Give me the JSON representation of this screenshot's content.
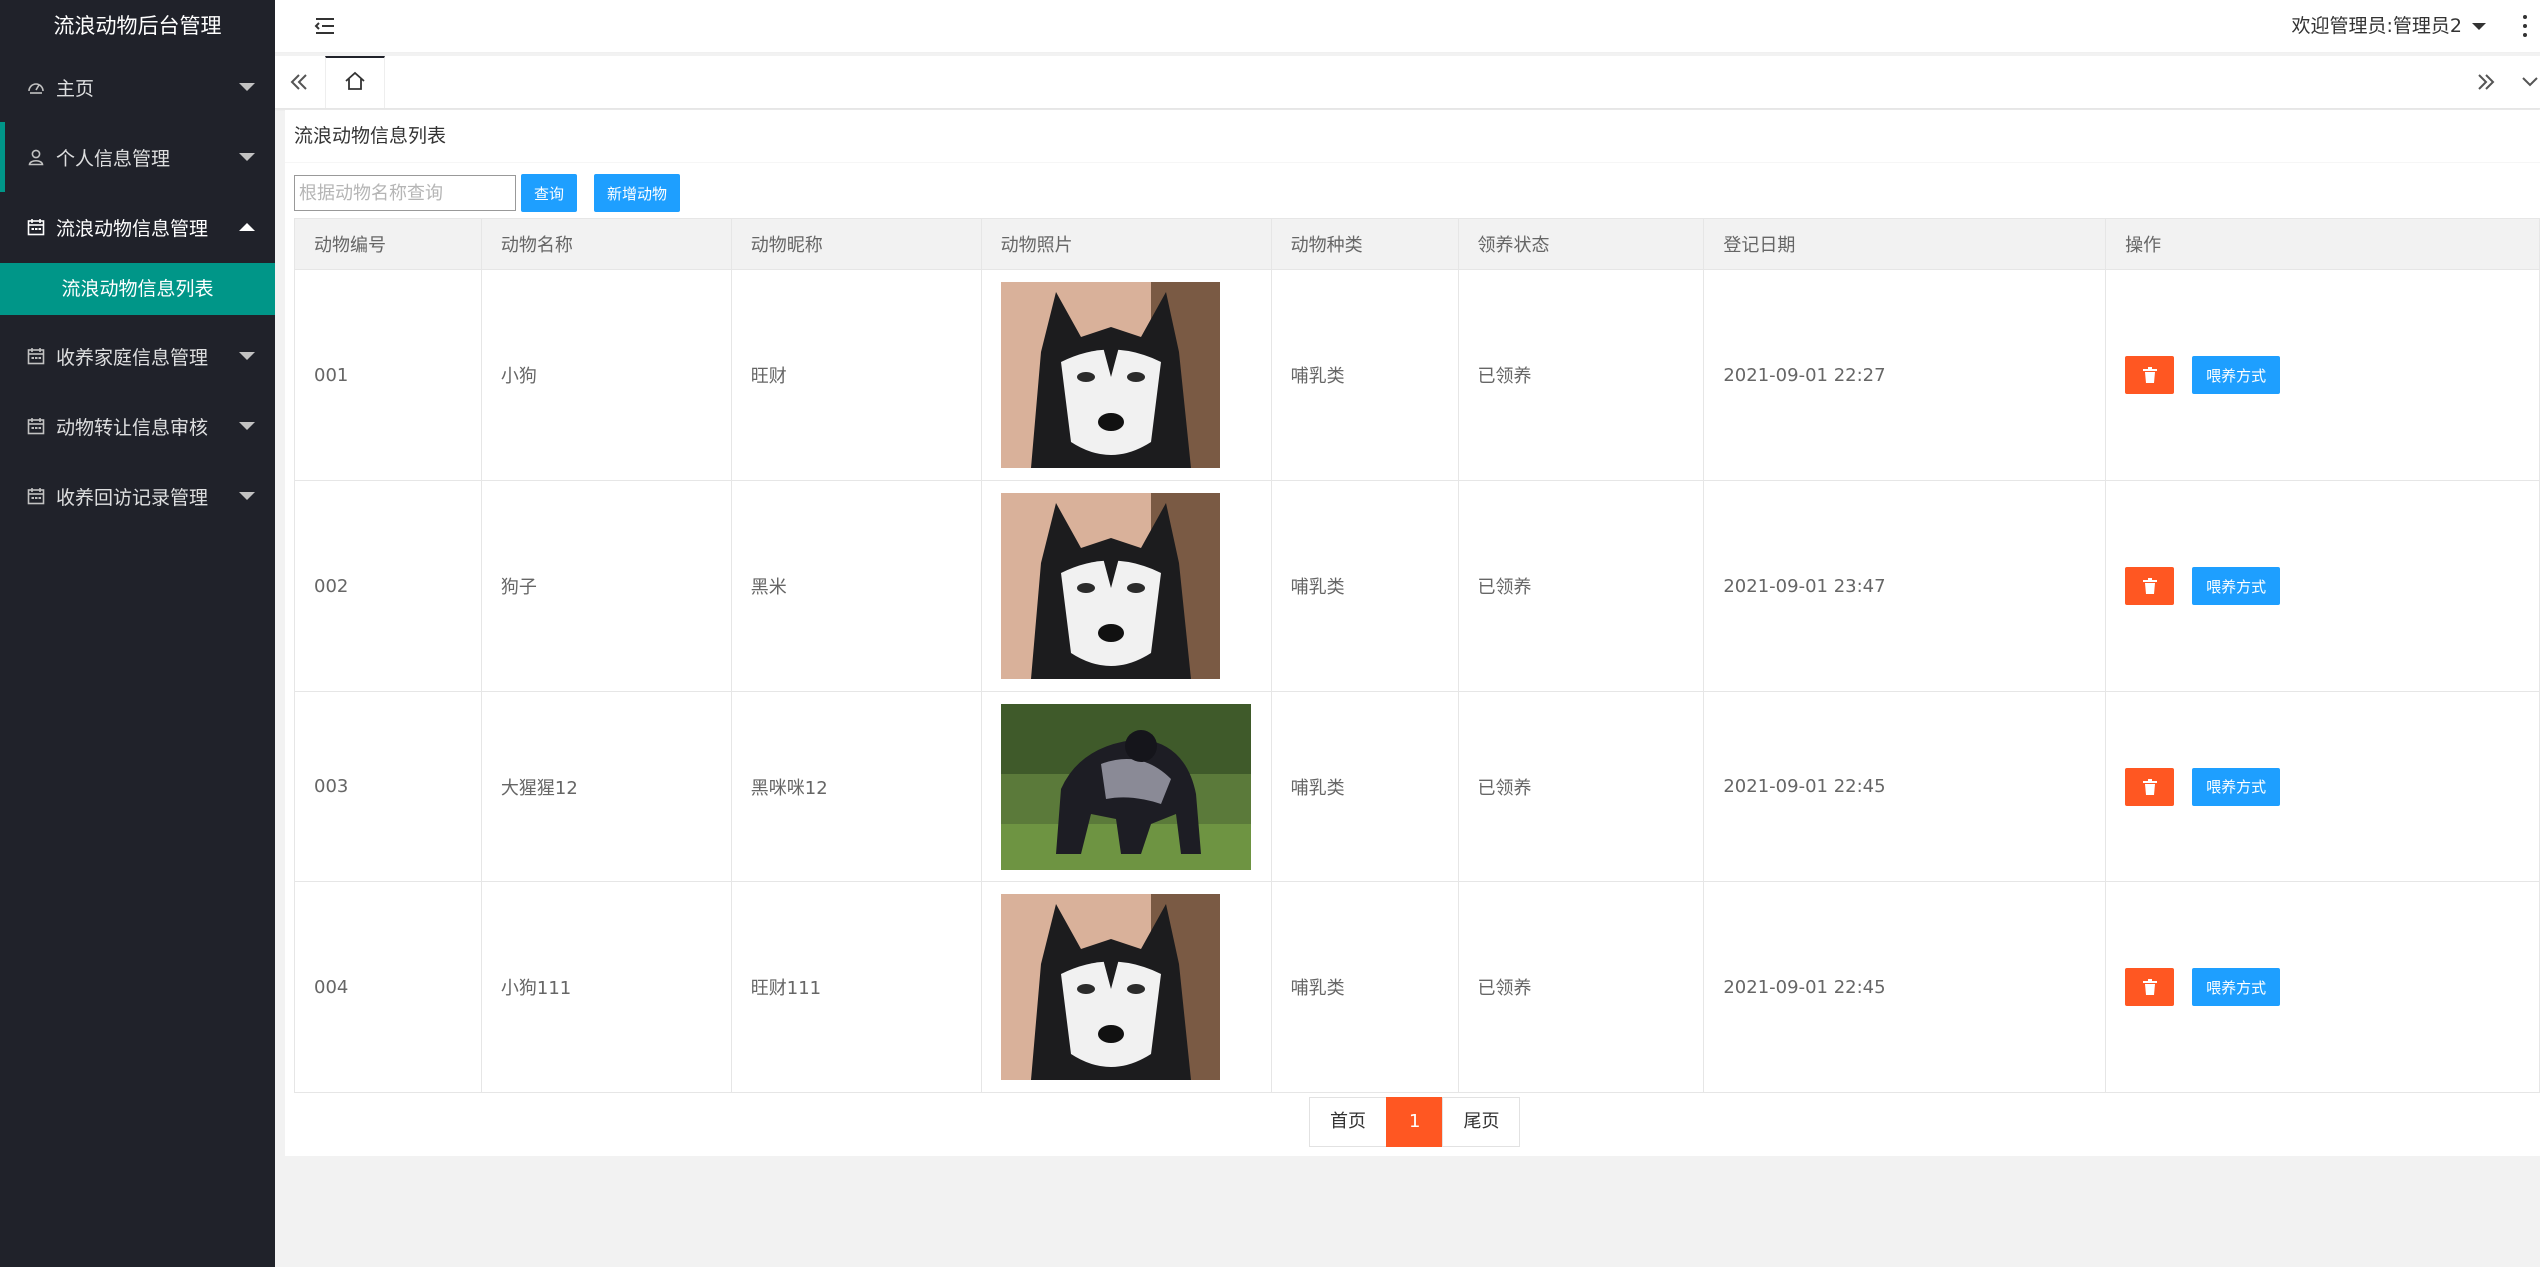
{
  "app": {
    "title": "流浪动物后台管理"
  },
  "sidebar": {
    "items": [
      {
        "label": "主页",
        "icon": "dashboard-icon"
      },
      {
        "label": "个人信息管理",
        "icon": "user-icon"
      },
      {
        "label": "流浪动物信息管理",
        "icon": "calendar-icon",
        "children": [
          {
            "label": "流浪动物信息列表"
          }
        ]
      },
      {
        "label": "收养家庭信息管理",
        "icon": "calendar-icon"
      },
      {
        "label": "动物转让信息审核",
        "icon": "calendar-icon"
      },
      {
        "label": "收养回访记录管理",
        "icon": "calendar-icon"
      }
    ]
  },
  "header": {
    "welcome": "欢迎管理员:管理员2"
  },
  "card": {
    "title": "流浪动物信息列表"
  },
  "search": {
    "placeholder": "根据动物名称查询",
    "button": "查询",
    "add_button": "新增动物"
  },
  "table": {
    "headers": [
      "动物编号",
      "动物名称",
      "动物昵称",
      "动物照片",
      "动物种类",
      "领养状态",
      "登记日期",
      "操作"
    ],
    "rows": [
      {
        "id": "001",
        "name": "小狗",
        "nickname": "旺财",
        "photo": "husky",
        "kind": "哺乳类",
        "status": "已领养",
        "date": "2021-09-01 22:27",
        "action": "喂养方式"
      },
      {
        "id": "002",
        "name": "狗子",
        "nickname": "黑米",
        "photo": "husky",
        "kind": "哺乳类",
        "status": "已领养",
        "date": "2021-09-01 23:47",
        "action": "喂养方式"
      },
      {
        "id": "003",
        "name": "大猩猩12",
        "nickname": "黑咪咪12",
        "photo": "gorilla",
        "kind": "哺乳类",
        "status": "已领养",
        "date": "2021-09-01 22:45",
        "action": "喂养方式"
      },
      {
        "id": "004",
        "name": "小狗111",
        "nickname": "旺财111",
        "photo": "husky",
        "kind": "哺乳类",
        "status": "已领养",
        "date": "2021-09-01 22:45",
        "action": "喂养方式"
      }
    ]
  },
  "pagination": {
    "first": "首页",
    "current": "1",
    "last": "尾页"
  },
  "colors": {
    "sidebar": "#20222a",
    "accent": "#009688",
    "primary": "#1e9fff",
    "danger": "#ff5722",
    "status": "#009f3f"
  }
}
